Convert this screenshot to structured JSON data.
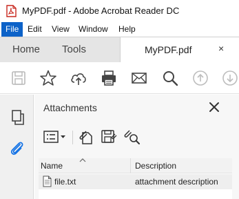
{
  "window": {
    "title": "MyPDF.pdf - Adobe Acrobat Reader DC"
  },
  "menu": {
    "items": [
      "File",
      "Edit",
      "View",
      "Window",
      "Help"
    ],
    "active": "File"
  },
  "tabs": {
    "home": "Home",
    "tools": "Tools",
    "document": "MyPDF.pdf",
    "close_glyph": "×"
  },
  "toolbar": {
    "icons": [
      "save-icon",
      "bookmark-star-icon",
      "upload-cloud-icon",
      "print-icon",
      "email-icon",
      "search-icon",
      "page-up-icon",
      "page-down-icon"
    ]
  },
  "leftrail": {
    "icons": [
      "pages-icon",
      "attachment-paperclip-icon"
    ],
    "active": "attachment-paperclip-icon"
  },
  "panel": {
    "title": "Attachments",
    "tools": [
      "options-menu-icon",
      "attach-file-icon",
      "save-attachment-icon",
      "search-attachment-icon"
    ]
  },
  "table": {
    "columns": [
      "Name",
      "Description"
    ],
    "rows": [
      {
        "name": "file.txt",
        "description": "attachment description"
      }
    ]
  },
  "colors": {
    "menu_active_bg": "#0c62c8",
    "accent": "#1473e6"
  }
}
